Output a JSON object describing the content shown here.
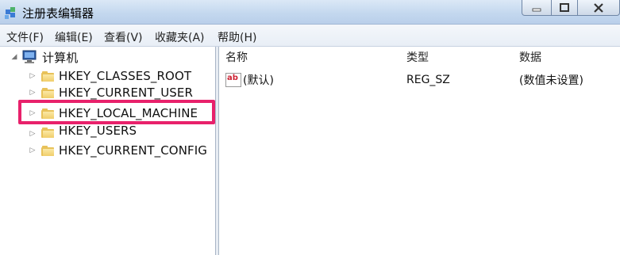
{
  "window": {
    "title": "注册表编辑器"
  },
  "menu": {
    "items": [
      "文件(F)",
      "编辑(E)",
      "查看(V)",
      "收藏夹(A)",
      "帮助(H)"
    ]
  },
  "tree": {
    "root": "计算机",
    "nodes": [
      {
        "label": "HKEY_CLASSES_ROOT"
      },
      {
        "label": "HKEY_CURRENT_USER"
      },
      {
        "label": "HKEY_LOCAL_MACHINE",
        "highlighted": true
      },
      {
        "label": "HKEY_USERS"
      },
      {
        "label": "HKEY_CURRENT_CONFIG"
      }
    ]
  },
  "list": {
    "columns": [
      "名称",
      "类型",
      "数据"
    ],
    "rows": [
      {
        "name": "(默认)",
        "type": "REG_SZ",
        "data": "(数值未设置)",
        "icon": "ab-string-icon"
      }
    ]
  },
  "colors": {
    "highlight_border": "#e8216b",
    "folder": "#e8c25a"
  }
}
